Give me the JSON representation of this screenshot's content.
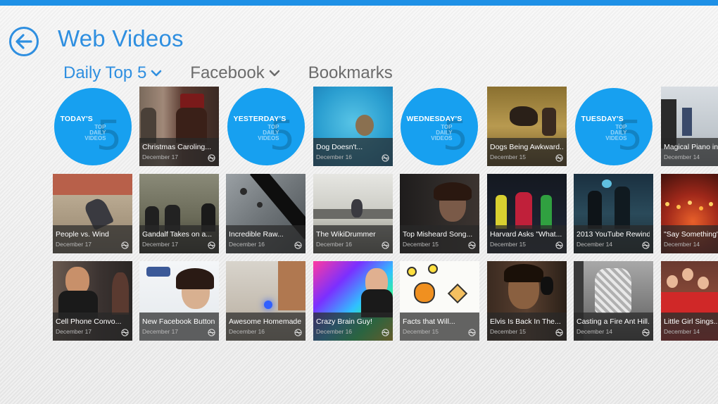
{
  "page": {
    "title": "Web Videos"
  },
  "nav": {
    "items": [
      {
        "label": "Daily Top 5",
        "dropdown": true,
        "active": true
      },
      {
        "label": "Facebook",
        "dropdown": true,
        "active": false
      },
      {
        "label": "Bookmarks",
        "dropdown": false,
        "active": false
      }
    ]
  },
  "colors": {
    "accent": "#2f8fe0",
    "top_bar": "#1e90e6",
    "circle": "#17a0f0"
  },
  "header_tiles": [
    {
      "day": "TODAY'S",
      "sub": "TOP DAILY VIDEOS",
      "num": "5"
    },
    {
      "day": "YESTERDAY'S",
      "sub": "TOP DAILY VIDEOS",
      "num": "5"
    },
    {
      "day": "WEDNESDAY'S",
      "sub": "TOP DAILY VIDEOS",
      "num": "5"
    },
    {
      "day": "TUESDAY'S",
      "sub": "TOP DAILY VIDEOS",
      "num": "5"
    }
  ],
  "videos": {
    "row1": [
      {
        "title": "Christmas Caroling...",
        "date": "December 17"
      },
      {
        "title": "Dog Doesn't...",
        "date": "December 16"
      },
      {
        "title": "Dogs Being Awkward...",
        "date": "December 15"
      },
      {
        "title": "Magical Piano in...",
        "date": "December 14"
      }
    ],
    "row2": [
      {
        "title": "People vs. Wind",
        "date": "December 17"
      },
      {
        "title": "Gandalf Takes on a...",
        "date": "December 17"
      },
      {
        "title": "Incredible Raw...",
        "date": "December 16"
      },
      {
        "title": "The WikiDrummer",
        "date": "December 16"
      },
      {
        "title": "Top Misheard Song...",
        "date": "December 15"
      },
      {
        "title": "Harvard Asks \"What...",
        "date": "December 15"
      },
      {
        "title": "2013 YouTube Rewind",
        "date": "December 14"
      },
      {
        "title": "\"Say Something\"",
        "date": "December 14"
      }
    ],
    "row3": [
      {
        "title": "Cell Phone Convo...",
        "date": "December 17"
      },
      {
        "title": "New Facebook Button!",
        "date": "December 17"
      },
      {
        "title": "Awesome Homemade...",
        "date": "December 16"
      },
      {
        "title": "Crazy Brain Guy!",
        "date": "December 16"
      },
      {
        "title": "Facts that Will...",
        "date": "December 15"
      },
      {
        "title": "Elvis Is Back In The...",
        "date": "December 15"
      },
      {
        "title": "Casting a Fire Ant Hill...",
        "date": "December 14"
      },
      {
        "title": "Little Girl Sings...",
        "date": "December 14"
      }
    ]
  },
  "icons": {
    "back": "back-arrow-icon",
    "dropdown": "chevron-down-icon",
    "share": "globe-icon"
  }
}
